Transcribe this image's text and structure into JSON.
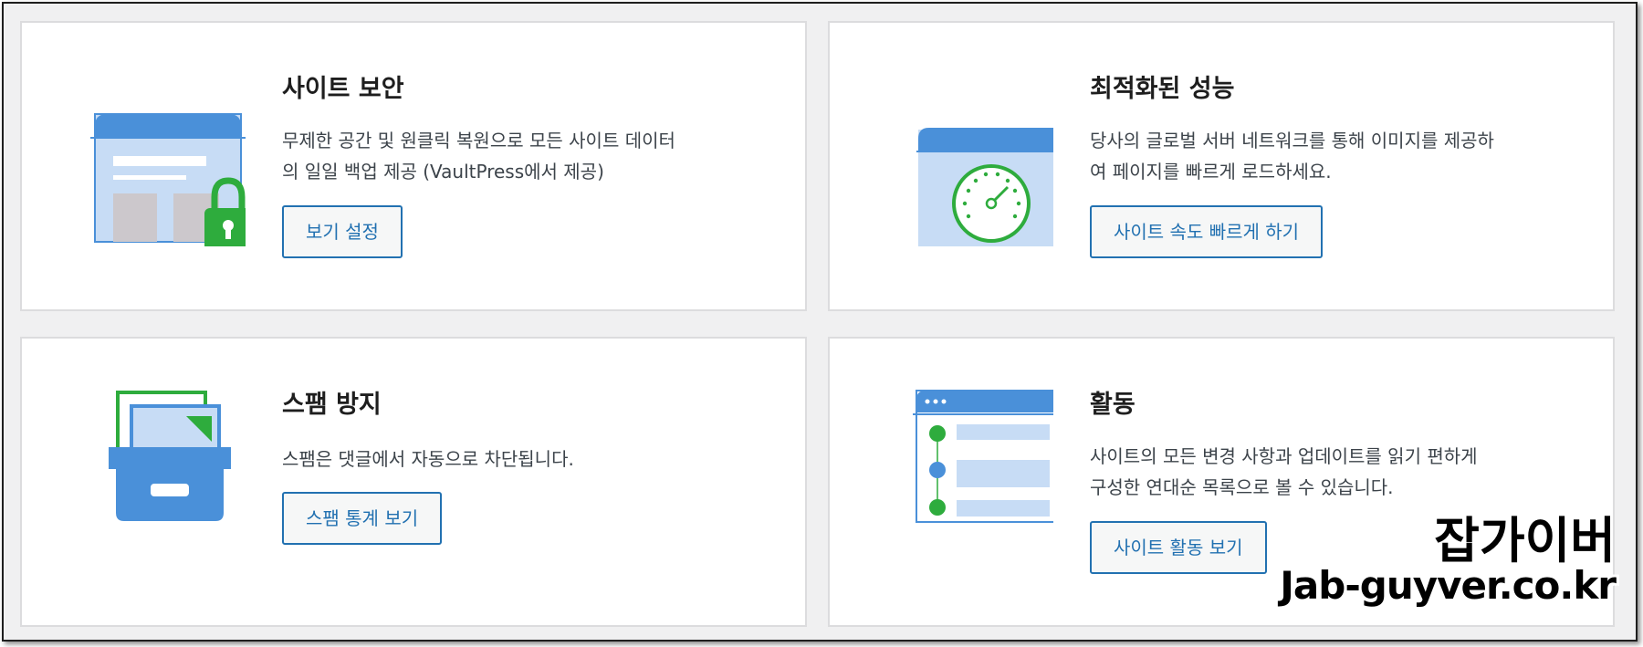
{
  "cards": {
    "security": {
      "title": "사이트 보안",
      "desc_line1": "무제한 공간 및 원클릭 복원으로 모든 사이트 데이터",
      "desc_line2": "의 일일 백업 제공 (VaultPress에서 제공)",
      "button": "보기 설정",
      "icon": "browser-lock-icon"
    },
    "performance": {
      "title": "최적화된 성능",
      "desc_line1": "당사의 글로벌 서버 네트워크를 통해 이미지를 제공하",
      "desc_line2": "여 페이지를 빠르게 로드하세요.",
      "button": "사이트 속도 빠르게 하기",
      "icon": "speedometer-icon"
    },
    "spam": {
      "title": "스팸 방지",
      "desc_line1": "스팸은 댓글에서 자동으로 차단됩니다.",
      "button": "스팸 통계 보기",
      "icon": "archive-box-icon"
    },
    "activity": {
      "title": "활동",
      "desc_line1": "사이트의 모든 변경 사항과 업데이트를 읽기 편하게",
      "desc_line2": "구성한 연대순 목록으로 볼 수 있습니다.",
      "button": "사이트 활동 보기",
      "icon": "activity-timeline-icon"
    }
  },
  "watermark": {
    "title": "잡가이버",
    "url": "Jab-guyver.co.kr"
  },
  "colors": {
    "accent": "#2271b1",
    "illustration_blue": "#4a90d9",
    "illustration_light_blue": "#c7dcf5",
    "green": "#2eac3d"
  }
}
